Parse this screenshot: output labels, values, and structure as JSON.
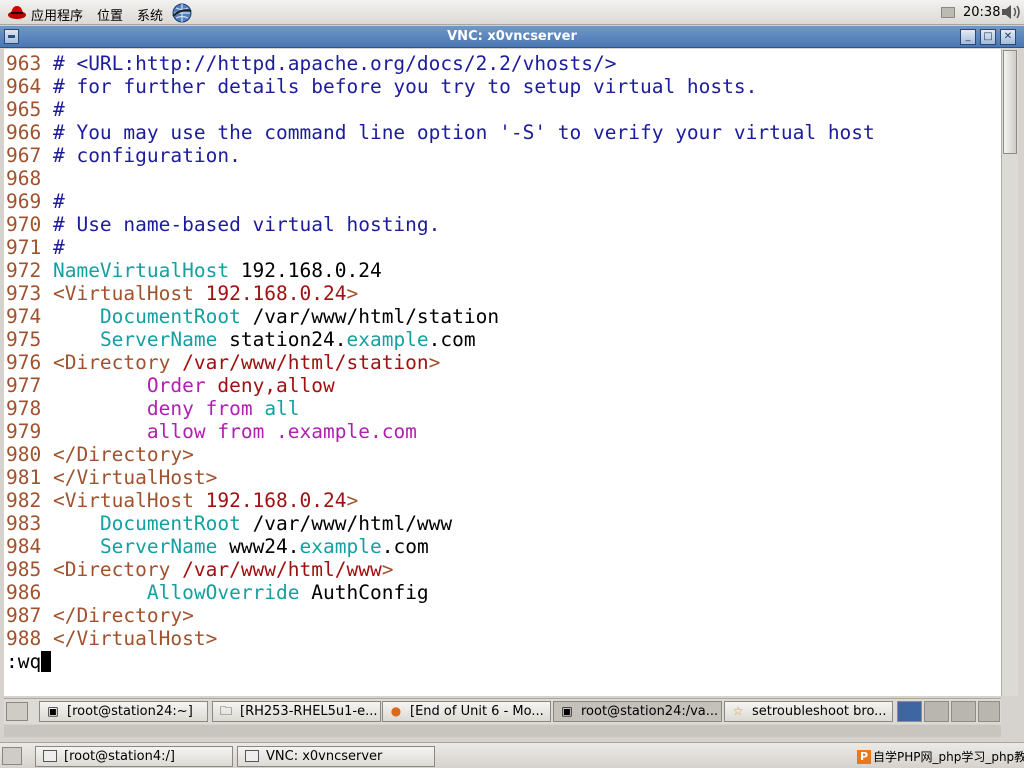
{
  "top_panel": {
    "menus": [
      "应用程序",
      "位置",
      "系统"
    ],
    "clock": "20:38"
  },
  "window": {
    "title": "VNC: x0vncserver"
  },
  "terminal": {
    "lines": [
      {
        "n": "963",
        "segs": [
          {
            "t": " # <URL:http://httpd.apache.org/docs/2.2/vhosts/>",
            "c": "comment"
          }
        ]
      },
      {
        "n": "964",
        "segs": [
          {
            "t": " # for further details before you try to setup virtual hosts.",
            "c": "comment"
          }
        ]
      },
      {
        "n": "965",
        "segs": [
          {
            "t": " #",
            "c": "comment"
          }
        ]
      },
      {
        "n": "966",
        "segs": [
          {
            "t": " # You may use the command line option '-S' to verify your virtual host",
            "c": "comment"
          }
        ]
      },
      {
        "n": "967",
        "segs": [
          {
            "t": " # configuration.",
            "c": "comment"
          }
        ]
      },
      {
        "n": "968",
        "segs": []
      },
      {
        "n": "969",
        "segs": [
          {
            "t": " #",
            "c": "comment"
          }
        ]
      },
      {
        "n": "970",
        "segs": [
          {
            "t": " # Use name-based virtual hosting.",
            "c": "comment"
          }
        ]
      },
      {
        "n": "971",
        "segs": [
          {
            "t": " #",
            "c": "comment"
          }
        ]
      },
      {
        "n": "972",
        "segs": [
          {
            "t": " NameVirtualHost",
            "c": "kw"
          },
          {
            "t": " 192.168.0.24",
            "c": "plain"
          }
        ]
      },
      {
        "n": "973",
        "segs": [
          {
            "t": " <VirtualHost",
            "c": "tag"
          },
          {
            "t": " 192.168.0.24",
            "c": "str"
          },
          {
            "t": ">",
            "c": "tag"
          }
        ]
      },
      {
        "n": "974",
        "segs": [
          {
            "t": "     ",
            "c": "plain"
          },
          {
            "t": "DocumentRoot",
            "c": "kw"
          },
          {
            "t": " /var/www/html/station",
            "c": "plain"
          }
        ]
      },
      {
        "n": "975",
        "segs": [
          {
            "t": "     ",
            "c": "plain"
          },
          {
            "t": "ServerName",
            "c": "kw"
          },
          {
            "t": " station24.",
            "c": "plain"
          },
          {
            "t": "example",
            "c": "kw"
          },
          {
            "t": ".com",
            "c": "plain"
          }
        ]
      },
      {
        "n": "976",
        "segs": [
          {
            "t": " <Directory",
            "c": "tag"
          },
          {
            "t": " /var/www/html/station",
            "c": "str"
          },
          {
            "t": ">",
            "c": "tag"
          }
        ]
      },
      {
        "n": "977",
        "segs": [
          {
            "t": "         ",
            "c": "plain"
          },
          {
            "t": "Order",
            "c": "mag"
          },
          {
            "t": " deny,allow",
            "c": "str"
          }
        ]
      },
      {
        "n": "978",
        "segs": [
          {
            "t": "         ",
            "c": "plain"
          },
          {
            "t": "deny from",
            "c": "mag"
          },
          {
            "t": " all",
            "c": "kw"
          }
        ]
      },
      {
        "n": "979",
        "segs": [
          {
            "t": "         ",
            "c": "plain"
          },
          {
            "t": "allow from .example.com",
            "c": "mag"
          }
        ]
      },
      {
        "n": "980",
        "segs": [
          {
            "t": " </Directory>",
            "c": "tag"
          }
        ]
      },
      {
        "n": "981",
        "segs": [
          {
            "t": " </VirtualHost>",
            "c": "tag"
          }
        ]
      },
      {
        "n": "982",
        "segs": [
          {
            "t": " <VirtualHost",
            "c": "tag"
          },
          {
            "t": " 192.168.0.24",
            "c": "str"
          },
          {
            "t": ">",
            "c": "tag"
          }
        ]
      },
      {
        "n": "983",
        "segs": [
          {
            "t": "     ",
            "c": "plain"
          },
          {
            "t": "DocumentRoot",
            "c": "kw"
          },
          {
            "t": " /var/www/html/www",
            "c": "plain"
          }
        ]
      },
      {
        "n": "984",
        "segs": [
          {
            "t": "     ",
            "c": "plain"
          },
          {
            "t": "ServerName",
            "c": "kw"
          },
          {
            "t": " www24.",
            "c": "plain"
          },
          {
            "t": "example",
            "c": "kw"
          },
          {
            "t": ".com",
            "c": "plain"
          }
        ]
      },
      {
        "n": "985",
        "segs": [
          {
            "t": " <Directory",
            "c": "tag"
          },
          {
            "t": " /var/www/html/www",
            "c": "str"
          },
          {
            "t": ">",
            "c": "tag"
          }
        ]
      },
      {
        "n": "986",
        "segs": [
          {
            "t": "         ",
            "c": "plain"
          },
          {
            "t": "AllowOverride",
            "c": "kw"
          },
          {
            "t": " AuthConfig",
            "c": "plain"
          }
        ]
      },
      {
        "n": "987",
        "segs": [
          {
            "t": " </Directory>",
            "c": "tag"
          }
        ]
      },
      {
        "n": "988",
        "segs": [
          {
            "t": " </VirtualHost>",
            "c": "tag"
          }
        ]
      }
    ],
    "command": ":wq"
  },
  "inner_taskbar": {
    "items": [
      {
        "label": "[root@station24:~]",
        "icon": "terminal-icon"
      },
      {
        "label": "[RH253-RHEL5u1-e...",
        "icon": "folder-icon"
      },
      {
        "label": "[End of Unit 6 - Mo...",
        "icon": "firefox-icon"
      },
      {
        "label": "root@station24:/va...",
        "icon": "terminal-icon"
      },
      {
        "label": "setroubleshoot bro...",
        "icon": "star-icon"
      }
    ]
  },
  "outer_taskbar": {
    "items": [
      {
        "label": "[root@station4:/]"
      },
      {
        "label": "VNC: x0vncserver"
      }
    ],
    "tray_text": "自学PHP网_php学习_php教程"
  },
  "colors": {
    "titlebar": "#4a77b4",
    "line_number": "#a0522d",
    "comment": "#1c1c9c",
    "keyword": "#14a0a0",
    "string": "#a01010",
    "magenta": "#b020b0"
  }
}
